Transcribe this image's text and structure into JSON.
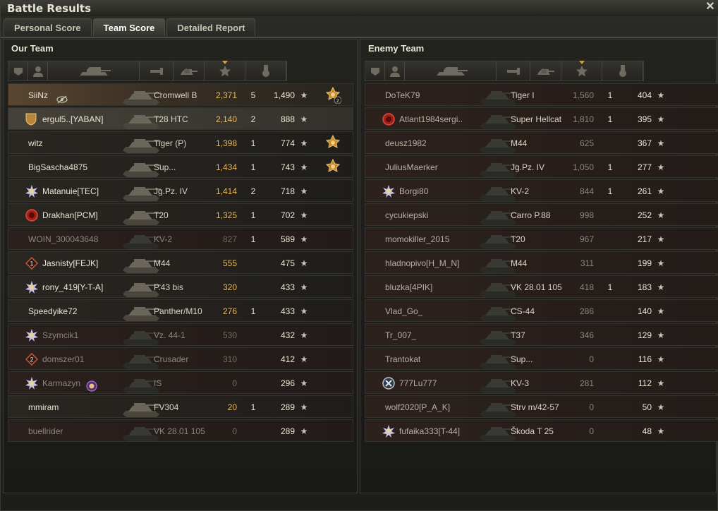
{
  "window": {
    "title": "Battle Results",
    "close_icon": "close-icon"
  },
  "tabs": [
    {
      "label": "Personal Score",
      "active": false
    },
    {
      "label": "Team Score",
      "active": true
    },
    {
      "label": "Detailed Report",
      "active": false
    }
  ],
  "our_team": {
    "title": "Our Team",
    "columns": [
      "squad-icon",
      "player-icon",
      "vehicle-icon",
      "damage-icon",
      "frags-icon",
      "xp-star-icon",
      "medal-icon"
    ],
    "rows": [
      {
        "player": "SiiNz",
        "vehicle": "Cromwell B",
        "damage": "2,371",
        "frags": "5",
        "xp": "1,490",
        "state": "self",
        "badge": "",
        "medal": "2"
      },
      {
        "player": "ergul5..[YABAN]",
        "vehicle": "T28 HTC",
        "damage": "2,140",
        "frags": "2",
        "xp": "888",
        "state": "platoon",
        "badge": "clan-shield",
        "medal": ""
      },
      {
        "player": "witz",
        "vehicle": "Tiger (P)",
        "damage": "1,398",
        "frags": "1",
        "xp": "774",
        "state": "alive",
        "badge": "",
        "medal": "1"
      },
      {
        "player": "BigSascha4875",
        "vehicle": "Sup...",
        "damage": "1,434",
        "frags": "1",
        "xp": "743",
        "state": "alive",
        "badge": "",
        "medal": "1"
      },
      {
        "player": "Matanuie[TEC]",
        "vehicle": "Jg.Pz. IV",
        "damage": "1,414",
        "frags": "2",
        "xp": "718",
        "state": "alive",
        "badge": "clan-star",
        "medal": ""
      },
      {
        "player": "Drakhan[PCM]",
        "vehicle": "T20",
        "damage": "1,325",
        "frags": "1",
        "xp": "702",
        "state": "alive",
        "badge": "clan-red",
        "medal": ""
      },
      {
        "player": "WOIN_300043648",
        "vehicle": "KV-2",
        "damage": "827",
        "frags": "1",
        "xp": "589",
        "state": "dead",
        "badge": "",
        "medal": ""
      },
      {
        "player": "Jasnisty[FEJK]",
        "vehicle": "M44",
        "damage": "555",
        "frags": "",
        "xp": "475",
        "state": "alive",
        "badge": "rank-1",
        "medal": ""
      },
      {
        "player": "rony_419[Y-T-A]",
        "vehicle": "P.43 bis",
        "damage": "320",
        "frags": "",
        "xp": "433",
        "state": "alive",
        "badge": "clan-star",
        "medal": ""
      },
      {
        "player": "Speedyike72",
        "vehicle": "Panther/M10",
        "damage": "276",
        "frags": "1",
        "xp": "433",
        "state": "alive",
        "badge": "",
        "medal": ""
      },
      {
        "player": "Szymcik1",
        "vehicle": "Vz. 44-1",
        "damage": "530",
        "frags": "",
        "xp": "432",
        "state": "dead",
        "badge": "clan-star",
        "medal": ""
      },
      {
        "player": "domszer01",
        "vehicle": "Crusader",
        "damage": "310",
        "frags": "",
        "xp": "412",
        "state": "dead",
        "badge": "rank-2",
        "medal": ""
      },
      {
        "player": "Karmazyn",
        "vehicle": "IS",
        "damage": "0",
        "frags": "",
        "xp": "296",
        "state": "dead",
        "badge": "clan-star",
        "medal": ""
      },
      {
        "player": "mmiram",
        "vehicle": "FV304",
        "damage": "20",
        "frags": "1",
        "xp": "289",
        "state": "alive",
        "badge": "",
        "medal": ""
      },
      {
        "player": "buellrider",
        "vehicle": "VK 28.01 105",
        "damage": "0",
        "frags": "",
        "xp": "289",
        "state": "dead",
        "badge": "",
        "medal": ""
      }
    ]
  },
  "enemy_team": {
    "title": "Enemy Team",
    "columns": [
      "squad-icon",
      "player-icon",
      "vehicle-icon",
      "damage-icon",
      "frags-icon",
      "xp-star-icon",
      "medal-icon"
    ],
    "rows": [
      {
        "player": "DoTeK79",
        "vehicle": "Tiger I",
        "damage": "1,560",
        "frags": "1",
        "xp": "404",
        "badge": ""
      },
      {
        "player": "Atlant1984sergi..",
        "vehicle": "Super Hellcat",
        "damage": "1,810",
        "frags": "1",
        "xp": "395",
        "badge": "clan-red"
      },
      {
        "player": "deusz1982",
        "vehicle": "M44",
        "damage": "625",
        "frags": "",
        "xp": "367",
        "badge": ""
      },
      {
        "player": "JuliusMaerker",
        "vehicle": "Jg.Pz. IV",
        "damage": "1,050",
        "frags": "1",
        "xp": "277",
        "badge": ""
      },
      {
        "player": "Borgi80",
        "vehicle": "KV-2",
        "damage": "844",
        "frags": "1",
        "xp": "261",
        "badge": "clan-star"
      },
      {
        "player": "cycukiepski",
        "vehicle": "Carro P.88",
        "damage": "998",
        "frags": "",
        "xp": "252",
        "badge": ""
      },
      {
        "player": "momokiller_2015",
        "vehicle": "T20",
        "damage": "967",
        "frags": "",
        "xp": "217",
        "badge": ""
      },
      {
        "player": "hladnopivo[H_M_N]",
        "vehicle": "M44",
        "damage": "311",
        "frags": "",
        "xp": "199",
        "badge": ""
      },
      {
        "player": "bluzka[4PIK]",
        "vehicle": "VK 28.01 105",
        "damage": "418",
        "frags": "1",
        "xp": "183",
        "badge": ""
      },
      {
        "player": "Vlad_Go_",
        "vehicle": "CS-44",
        "damage": "286",
        "frags": "",
        "xp": "140",
        "badge": ""
      },
      {
        "player": "Tr_007_",
        "vehicle": "T37",
        "damage": "346",
        "frags": "",
        "xp": "129",
        "badge": ""
      },
      {
        "player": "Trantokat",
        "vehicle": "Sup...",
        "damage": "0",
        "frags": "",
        "xp": "116",
        "badge": ""
      },
      {
        "player": "777Lu777",
        "vehicle": "KV-3",
        "damage": "281",
        "frags": "",
        "xp": "112",
        "badge": "clan-x"
      },
      {
        "player": "wolf2020[P_A_K]",
        "vehicle": "Strv m/42-57",
        "damage": "0",
        "frags": "",
        "xp": "50",
        "badge": ""
      },
      {
        "player": "fufaika333[T-44]",
        "vehicle": "Škoda T 25",
        "damage": "0",
        "frags": "",
        "xp": "48",
        "badge": "clan-star"
      }
    ]
  },
  "colors": {
    "damage_gold": "#e4b85c",
    "accent": "#c8a24a"
  }
}
